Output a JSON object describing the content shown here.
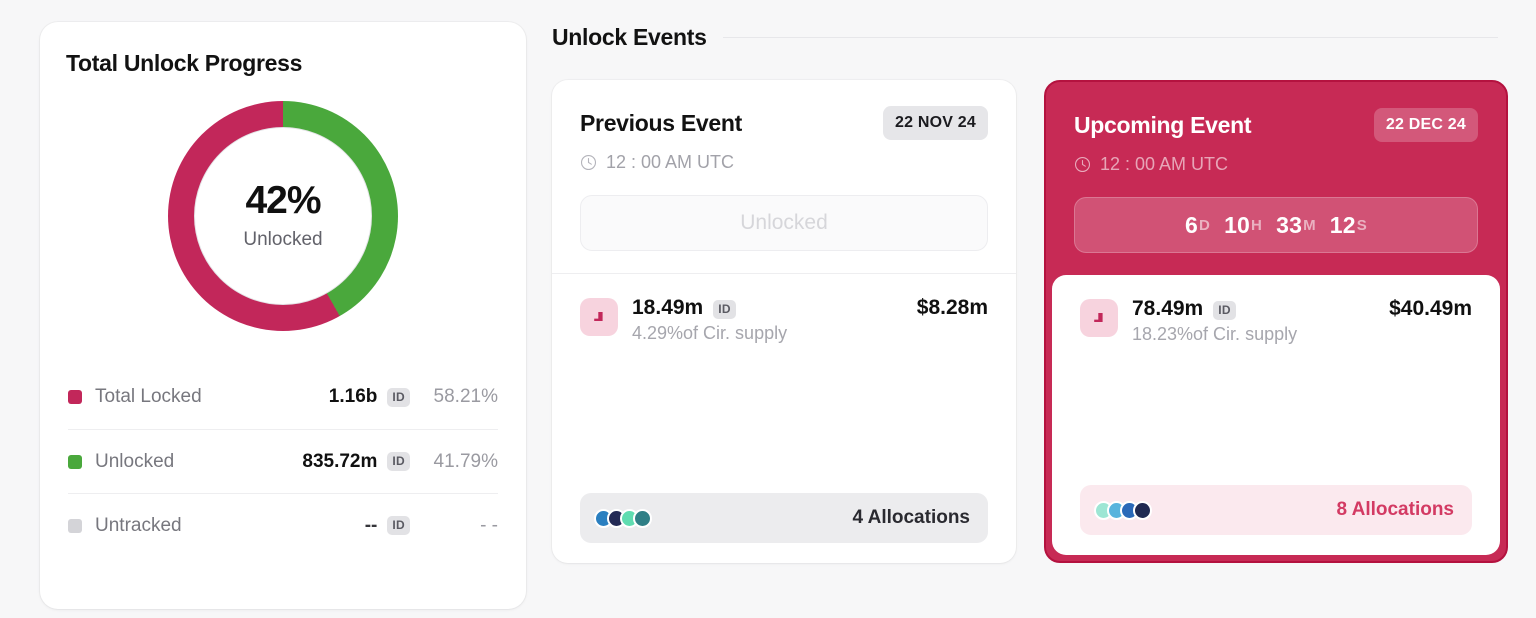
{
  "colors": {
    "locked": "#c2275a",
    "unlocked": "#4aa83c",
    "untracked": "#d4d4d8",
    "brand": "#c72a55",
    "brand_border": "#b4123f",
    "page_bg": "#f7f7f8"
  },
  "progress_card": {
    "title": "Total Unlock Progress",
    "donut_percent_label": "42%",
    "donut_sub_label": "Unlocked",
    "legend": [
      {
        "label": "Total Locked",
        "value": "1.16b",
        "unit": "ID",
        "percent": "58.21%",
        "swatch": "#c2275a"
      },
      {
        "label": "Unlocked",
        "value": "835.72m",
        "unit": "ID",
        "percent": "41.79%",
        "swatch": "#4aa83c"
      },
      {
        "label": "Untracked",
        "value": "--",
        "unit": "ID",
        "percent": "- -",
        "swatch": "#d4d4d8"
      }
    ]
  },
  "events": {
    "section_title": "Unlock Events",
    "previous": {
      "title": "Previous Event",
      "date_badge": "22 NOV 24",
      "time": "12 : 00 AM UTC",
      "status": "Unlocked",
      "amount": "18.49m",
      "amount_unit": "ID",
      "amount_usd": "$8.28m",
      "supply_share": "4.29%of Cir. supply",
      "allocations_count": "4 Allocations",
      "allocation_dots": [
        "#2a7fc0",
        "#232a55",
        "#5fdcb0",
        "#2f7f86"
      ]
    },
    "upcoming": {
      "title": "Upcoming Event",
      "date_badge": "22 DEC 24",
      "time": "12 : 00 AM UTC",
      "countdown": {
        "days": "6",
        "days_unit": "D",
        "hours": "10",
        "hours_unit": "H",
        "minutes": "33",
        "minutes_unit": "M",
        "seconds": "12",
        "seconds_unit": "S"
      },
      "amount": "78.49m",
      "amount_unit": "ID",
      "amount_usd": "$40.49m",
      "supply_share": "18.23%of Cir. supply",
      "allocations_count": "8 Allocations",
      "allocation_dots": [
        "#9de6d4",
        "#58b4dd",
        "#2a69b8",
        "#202a52"
      ]
    }
  },
  "chart_data": {
    "type": "pie",
    "title": "Total Unlock Progress",
    "categories": [
      "Unlocked",
      "Total Locked",
      "Untracked"
    ],
    "values": [
      41.79,
      58.21,
      0
    ],
    "value_labels": [
      "835.72m",
      "1.16b",
      "--"
    ],
    "colors": [
      "#4aa83c",
      "#c2275a",
      "#d4d4d8"
    ],
    "center_label": "42%",
    "center_sublabel": "Unlocked",
    "unit": "ID",
    "legend_position": "bottom",
    "donut": true
  }
}
